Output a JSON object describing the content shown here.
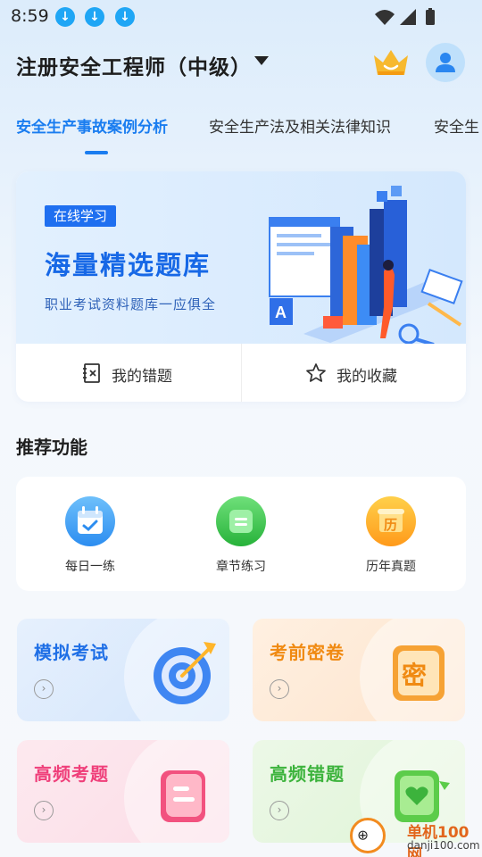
{
  "status_bar": {
    "time": "8:59"
  },
  "header": {
    "title": "注册安全工程师（中级）",
    "crown_icon": "crown-icon",
    "avatar_icon": "user-avatar-icon"
  },
  "tabs": [
    {
      "label": "安全生产事故案例分析",
      "active": true
    },
    {
      "label": "安全生产法及相关法律知识",
      "active": false
    },
    {
      "label": "安全生",
      "active": false
    }
  ],
  "banner": {
    "tag": "在线学习",
    "title": "海量精选题库",
    "subtitle": "职业考试资料题库一应俱全",
    "actions": [
      {
        "label": "我的错题",
        "icon": "wrong-questions-icon"
      },
      {
        "label": "我的收藏",
        "icon": "star-icon"
      }
    ]
  },
  "recommend": {
    "title": "推荐功能",
    "items": [
      {
        "label": "每日一练",
        "icon": "calendar-icon"
      },
      {
        "label": "章节练习",
        "icon": "chapter-icon"
      },
      {
        "label": "历年真题",
        "icon": "history-icon"
      }
    ]
  },
  "tiles": [
    {
      "label": "模拟考试",
      "icon": "target-icon",
      "color": "#1f6fe6"
    },
    {
      "label": "考前密卷",
      "icon": "secret-paper-icon",
      "color": "#f08a12"
    },
    {
      "label": "高频考题",
      "icon": "frequent-questions-icon",
      "color": "#ef3f7a"
    },
    {
      "label": "高频错题",
      "icon": "frequent-wrong-icon",
      "color": "#3cb33c"
    }
  ],
  "colors": {
    "accent": "#1a7df0",
    "download_badge": "#1fa6f5"
  },
  "watermark": {
    "brand": "单机100网",
    "domain": "danji100.com"
  }
}
